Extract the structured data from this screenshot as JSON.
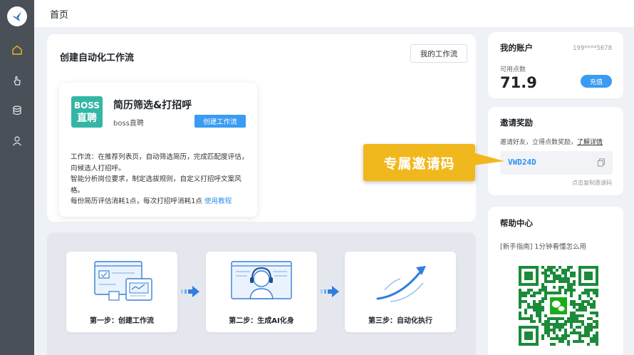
{
  "header": {
    "title": "首页"
  },
  "sidebar": {
    "items": [
      {
        "icon": "home-icon"
      },
      {
        "icon": "pointer-icon"
      },
      {
        "icon": "database-icon"
      },
      {
        "icon": "user-icon"
      }
    ]
  },
  "workflow": {
    "section_title": "创建自动化工作流",
    "my_workflows_label": "我的工作流",
    "card": {
      "logo_line1": "BOSS",
      "logo_line2": "直聘",
      "name": "简历筛选&打招呼",
      "platform": "boss直聘",
      "create_label": "创建工作流",
      "desc_line1": "工作流：在推荐列表页，自动筛选简历，完成匹配度评估，向候选人打招呼。",
      "desc_line2": "智能分析岗位要求，制定选拔规则，自定义打招呼文案风格。",
      "desc_line3": "每份简历评估消耗1点，每次打招呼消耗1点",
      "tutorial_label": "使用教程"
    }
  },
  "steps": [
    {
      "label": "第一步：创建工作流"
    },
    {
      "label": "第二步：生成AI化身"
    },
    {
      "label": "第三步：自动化执行"
    }
  ],
  "account": {
    "title": "我的账户",
    "phone": "199****5678",
    "points_label": "可用点数",
    "points": "71.9",
    "recharge_label": "充值"
  },
  "reward": {
    "title": "邀请奖励",
    "desc": "邀请好友，立得点数奖励，",
    "details_label": "了解详情",
    "code": "VWD24D",
    "copy_hint": "点击复制邀请码",
    "callout": "专属邀请码"
  },
  "help": {
    "title": "帮助中心",
    "text": "[新手指南] 1分钟看懂怎么用"
  },
  "colors": {
    "accent": "#3a9bf2",
    "callout": "#f1b81d",
    "sidebar": "#4a5057"
  }
}
